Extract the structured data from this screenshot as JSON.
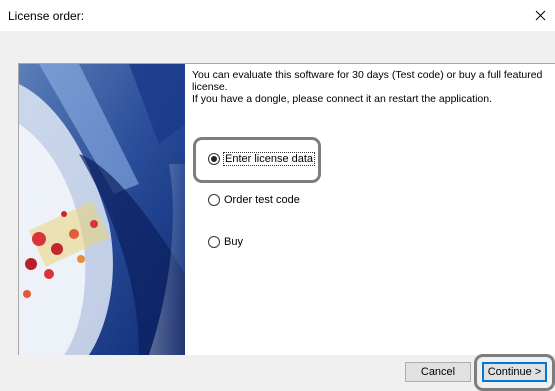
{
  "window": {
    "title": "License order:"
  },
  "intro": {
    "line1": "You can evaluate this software for 30 days (Test code) or buy a full featured",
    "line2": "license.",
    "line3": "If you have a dongle, please connect it an restart the application."
  },
  "options": [
    {
      "label": "Enter license data",
      "checked": true
    },
    {
      "label": "Order test code",
      "checked": false
    },
    {
      "label": "Buy",
      "checked": false
    }
  ],
  "buttons": {
    "cancel": "Cancel",
    "continue": "Continue >"
  },
  "colors": {
    "accent": "#0078d7",
    "highlight": "#7d7d7d"
  }
}
